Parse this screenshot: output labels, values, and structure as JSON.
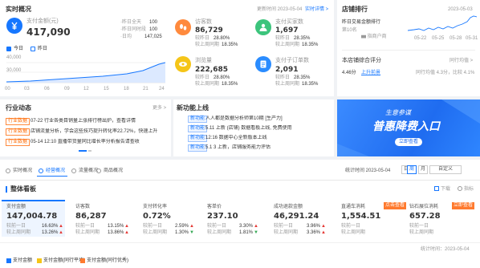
{
  "realtime": {
    "title": "实时概况",
    "update_time": "更新时间 2023-05-04",
    "detail_link": "实时详情 >",
    "amount_label": "支付金额(元)",
    "amount_value": "417,090",
    "side_stats": [
      {
        "label": "·昨日全天",
        "value": "100"
      },
      {
        "label": "·昨日同时段",
        "value": "100"
      },
      {
        "label": "·日均",
        "value": "147,025"
      }
    ],
    "legend_today": "今日",
    "legend_yesterday": "昨日",
    "y_labels": [
      "40,000",
      "30,000"
    ],
    "x_labels": [
      "00",
      "03",
      "06",
      "09",
      "12",
      "15",
      "18",
      "21",
      "24"
    ],
    "metrics": [
      {
        "label": "访客数",
        "value": "86,729",
        "cmp1": "较昨日",
        "pct1": "28.80%",
        "cmp2": "较上周同期",
        "pct2": "18.35%",
        "color": "#ff8a3d",
        "icon": "footprint-icon"
      },
      {
        "label": "支付买家数",
        "value": "1,697",
        "cmp1": "较昨日",
        "pct1": "28.35%",
        "cmp2": "较上周同期",
        "pct2": "18.35%",
        "color": "#3cc47c",
        "icon": "users-icon"
      },
      {
        "label": "浏览量",
        "value": "222,685",
        "cmp1": "较昨日",
        "pct1": "28.80%",
        "cmp2": "较上周同期",
        "pct2": "18.35%",
        "color": "#f5c518",
        "icon": "eye-icon"
      },
      {
        "label": "支付子订单数",
        "value": "2,091",
        "cmp1": "较昨日",
        "pct1": "28.35%",
        "cmp2": "较上周同期",
        "pct2": "18.35%",
        "color": "#2a8cff",
        "icon": "order-icon"
      }
    ]
  },
  "ranking": {
    "title": "店铺排行",
    "date": "2023-05-03",
    "today_label": "昨日交易金额排行",
    "rank_desc": "第10名",
    "store_name": "▅ 指商户商",
    "x_labels": [
      "05-22",
      "05-25",
      "05-28",
      "05-31"
    ],
    "mid_title": "本店铺综合评分",
    "mid_right": "同行均值 >",
    "mid_value": "4.46分",
    "mid_link": "上升前景",
    "mid_sub": "同行均值 4.3分，比较 4.1%"
  },
  "notice": {
    "title": "行业动态",
    "more": "更多 >",
    "items": [
      {
        "tag": "行业数据",
        "text": "07-22 行业各类目销量上涨排行榜出炉，查看详情"
      },
      {
        "tag": "行业数据",
        "text": "店铺流量分析，学会这些技巧提升转化率22.72%，快速上升"
      },
      {
        "tag": "行业数据",
        "text": "05-14 12:10 直播带货量同比增长率分析报告请查收"
      }
    ]
  },
  "updates": {
    "title": "新功能上线",
    "items": [
      {
        "tag": "新功能",
        "text": "人人都是数据分析师第10期 [生产力]"
      },
      {
        "tag": "新功能",
        "text": "5.11 上新 (店铺) 数据看板上线, 免费使用"
      },
      {
        "tag": "新功能",
        "text": "12:16 数据中心全新版本上线"
      },
      {
        "tag": "新功能",
        "text": "5.1 3 上新，店铺服务能力评估"
      }
    ]
  },
  "banner": {
    "top": "生意参谋",
    "main": "普惠降费入口",
    "button": "立即查看"
  },
  "tabs": [
    {
      "label": "实时概况",
      "active": false
    },
    {
      "label": "经营概况",
      "active": true
    },
    {
      "label": "流量概况",
      "active": false
    },
    {
      "label": "商品概况",
      "active": false
    }
  ],
  "date_bar": {
    "label": "统计时间 2023-05-04",
    "buttons": [
      "日",
      "周",
      "月",
      "自定义"
    ]
  },
  "overview": {
    "title": "整体看板",
    "actions": [
      "下载",
      "指标"
    ],
    "kpis": [
      {
        "label": "支付金额",
        "value": "147,004.78",
        "cmp1": "较前一日",
        "pct1": "16.63%",
        "cmp2": "较上周同期",
        "pct2": "13.26%"
      },
      {
        "label": "访客数",
        "value": "86,287",
        "cmp1": "较前一日",
        "pct1": "13.15%",
        "cmp2": "较上周同期",
        "pct2": "13.86%"
      },
      {
        "label": "支付转化率",
        "value": "0.72%",
        "cmp1": "较前一日",
        "pct1": "2.59%",
        "cmp2": "较上周同期",
        "pct2": "1.30%"
      },
      {
        "label": "客单价",
        "value": "237.10",
        "cmp1": "较前一日",
        "pct1": "3.30%",
        "cmp2": "较上周同期",
        "pct2": "1.81%"
      },
      {
        "label": "成功退款金额",
        "value": "46,291.24",
        "cmp1": "较前一日",
        "pct1": "3.96%",
        "cmp2": "较上周同期",
        "pct2": "3.36%"
      },
      {
        "label": "直通车消耗",
        "value": "1,554.51",
        "cmp1": "较前一日",
        "pct1": "",
        "cmp2": "较上周同期",
        "pct2": "",
        "badge": "点击查看"
      },
      {
        "label": "钻石展位消耗",
        "value": "657.28",
        "cmp1": "较前一日",
        "pct1": "",
        "cmp2": "较上周同期",
        "pct2": "",
        "badge": "立即查看"
      }
    ],
    "footer_note": "统计时间：2023-05-04",
    "legend": [
      "支付金额",
      "支付金额(同行平均)",
      "支付金额(同行优秀)"
    ]
  }
}
